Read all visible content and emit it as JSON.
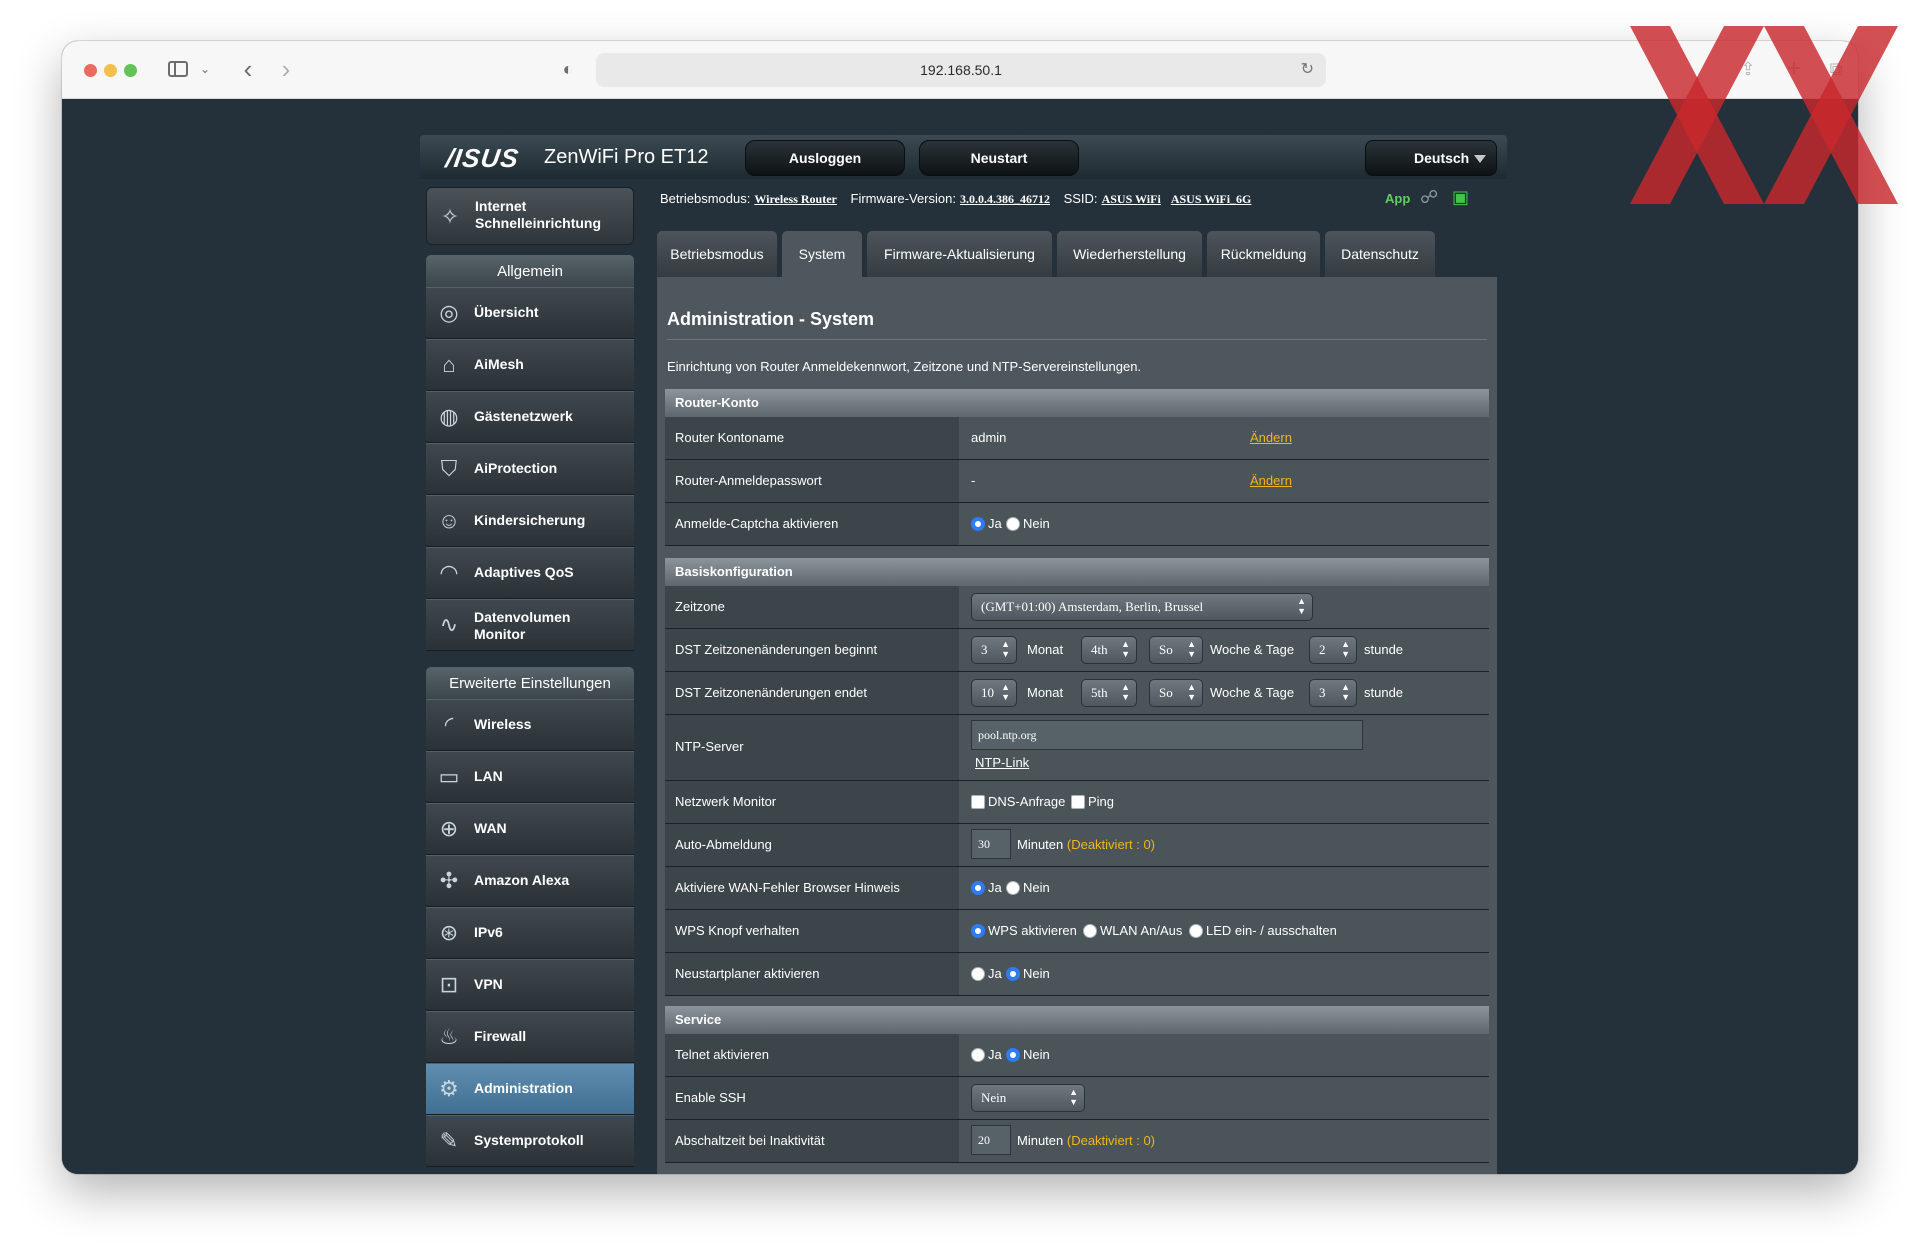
{
  "browser": {
    "url": "192.168.50.1",
    "icons": {
      "sidebar": "sidebar-icon",
      "back": "chevron-left-icon",
      "forward": "chevron-right-icon",
      "shield": "shield-icon",
      "reload": "reload-icon",
      "share": "share-icon",
      "new_tab": "plus-icon",
      "tabs": "tabs-overview-icon"
    }
  },
  "router": {
    "brand": "/ISUS",
    "model": "ZenWiFi Pro ET12",
    "logout": "Ausloggen",
    "reboot": "Neustart",
    "language": "Deutsch",
    "status": {
      "mode_label": "Betriebsmodus:",
      "mode_value": "Wireless Router",
      "fw_label": "Firmware-Version:",
      "fw_value": "3.0.0.4.386_46712",
      "ssid_label": "SSID:",
      "ssid_1": "ASUS WiFi",
      "ssid_2": "ASUS WiFi_6G",
      "app": "App"
    },
    "nav": {
      "qis_1": "Internet",
      "qis_2": "Schnelleinrichtung",
      "general_title": "Allgemein",
      "general": [
        {
          "label": "Übersicht",
          "icon": "globe-network-icon"
        },
        {
          "label": "AiMesh",
          "icon": "aimesh-icon"
        },
        {
          "label": "Gästenetzwerk",
          "icon": "guest-network-icon"
        },
        {
          "label": "AiProtection",
          "icon": "shield-lock-icon"
        },
        {
          "label": "Kindersicherung",
          "icon": "family-icon"
        },
        {
          "label": "Adaptives QoS",
          "icon": "gauge-icon"
        },
        {
          "label_1": "Datenvolumen",
          "label_2": "Monitor",
          "icon": "traffic-monitor-icon"
        }
      ],
      "advanced_title": "Erweiterte Einstellungen",
      "advanced": [
        {
          "label": "Wireless",
          "icon": "wireless-icon"
        },
        {
          "label": "LAN",
          "icon": "lan-icon"
        },
        {
          "label": "WAN",
          "icon": "wan-globe-icon"
        },
        {
          "label": "Amazon Alexa",
          "icon": "alexa-icon"
        },
        {
          "label": "IPv6",
          "icon": "ipv6-icon"
        },
        {
          "label": "VPN",
          "icon": "vpn-icon"
        },
        {
          "label": "Firewall",
          "icon": "firewall-icon"
        },
        {
          "label": "Administration",
          "icon": "admin-gear-icon"
        },
        {
          "label": "Systemprotokoll",
          "icon": "syslog-icon"
        }
      ]
    },
    "tabs": [
      "Betriebsmodus",
      "System",
      "Firmware-Aktualisierung",
      "Wiederherstellung",
      "Rückmeldung",
      "Datenschutz"
    ],
    "active_tab": "System",
    "page": {
      "title": "Administration - System",
      "description": "Einrichtung von Router Anmeldekennwort, Zeitzone und NTP-Servereinstellungen.",
      "account": {
        "head": "Router-Konto",
        "name_label": "Router Kontoname",
        "name_value": "admin",
        "change": "Ändern",
        "pw_label": "Router-Anmeldepasswort",
        "pw_value": "-",
        "captcha_label": "Anmelde-Captcha aktivieren",
        "yes": "Ja",
        "no": "Nein",
        "captcha_selected": "Ja"
      },
      "basic": {
        "head": "Basiskonfiguration",
        "tz_label": "Zeitzone",
        "tz_value": "(GMT+01:00) Amsterdam, Berlin, Brussel",
        "dst_start_label": "DST Zeitzonenänderungen beginnt",
        "dst_start": {
          "month": "3",
          "week": "4th",
          "day": "So",
          "hour": "2"
        },
        "dst_end_label": "DST Zeitzonenänderungen endet",
        "dst_end": {
          "month": "10",
          "week": "5th",
          "day": "So",
          "hour": "3"
        },
        "month_word": "Monat",
        "weekday_word": "Woche & Tage",
        "hour_word": "stunde",
        "ntp_label": "NTP-Server",
        "ntp_value": "pool.ntp.org",
        "ntp_link": "NTP-Link",
        "netmon_label": "Netzwerk Monitor",
        "dns": "DNS-Anfrage",
        "ping": "Ping",
        "autologout_label": "Auto-Abmeldung",
        "autologout_value": "30",
        "minutes": "Minuten",
        "disabled_hint": "(Deaktiviert : 0)",
        "wanerr_label": "Aktiviere WAN-Fehler Browser Hinweis",
        "wanerr_selected": "Ja",
        "wps_label": "WPS Knopf verhalten",
        "wps_opt1": "WPS aktivieren",
        "wps_opt2": "WLAN An/Aus",
        "wps_opt3": "LED ein- / ausschalten",
        "wps_selected": "WPS aktivieren",
        "reboot_label": "Neustartplaner aktivieren",
        "reboot_selected": "Nein"
      },
      "service": {
        "head": "Service",
        "telnet_label": "Telnet aktivieren",
        "telnet_selected": "Nein",
        "ssh_label": "Enable SSH",
        "ssh_value": "Nein",
        "idle_label": "Abschaltzeit bei Inaktivität",
        "idle_value": "20"
      }
    }
  },
  "colors": {
    "accent_link": "#f3b51a",
    "radio_on": "#2f7bf6",
    "active_nav": "#4f7fa3",
    "watermark": "#c8282d"
  }
}
